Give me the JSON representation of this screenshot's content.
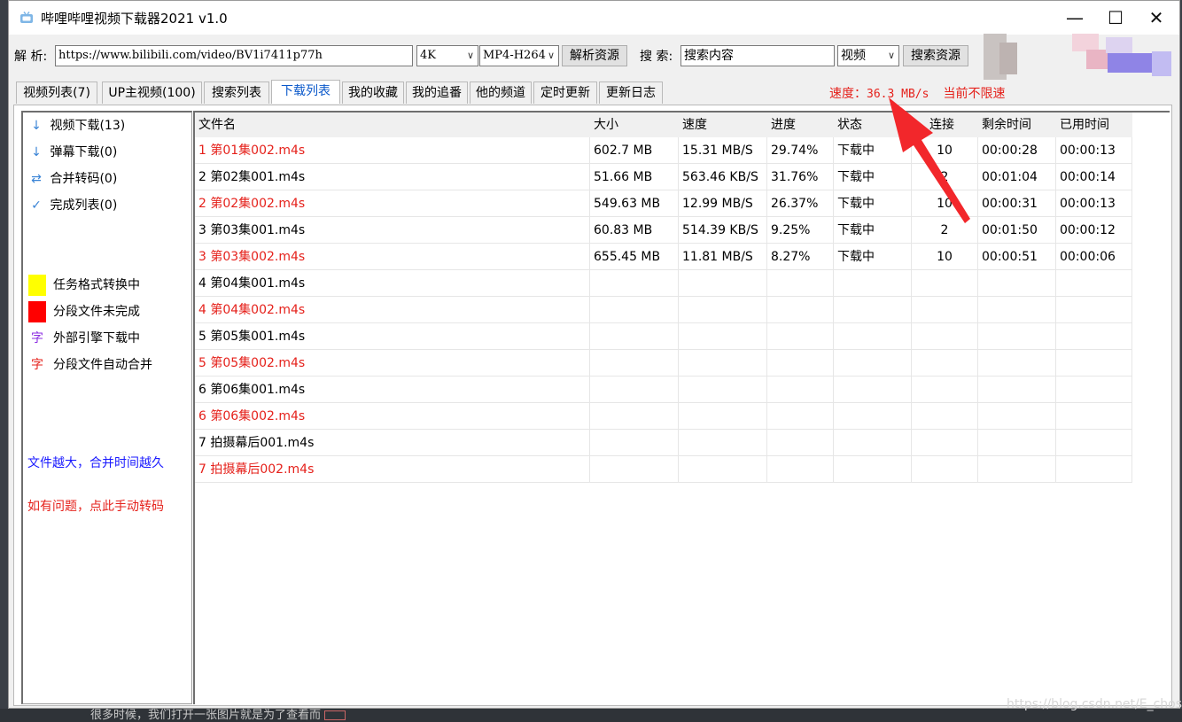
{
  "window": {
    "title": "哔哩哔哩视频下载器2021 v1.0",
    "controls": {
      "minimize": "—",
      "maximize": "☐",
      "close": "✕"
    }
  },
  "toolbar": {
    "parse_label": "解 析:",
    "url_value": "https://www.bilibili.com/video/BV1i7411p77h",
    "quality_value": "4K",
    "codec_value": "MP4-H264",
    "parse_button": "解析资源",
    "search_label": "搜 索:",
    "search_value": "搜索内容",
    "search_type_value": "视频",
    "search_button": "搜索资源"
  },
  "tabs": [
    {
      "label": "视频列表(7)"
    },
    {
      "label": "UP主视频(100)"
    },
    {
      "label": "搜索列表"
    },
    {
      "label": "下载列表",
      "active": true
    },
    {
      "label": "我的收藏"
    },
    {
      "label": "我的追番"
    },
    {
      "label": "他的频道"
    },
    {
      "label": "定时更新"
    },
    {
      "label": "更新日志"
    }
  ],
  "speed": {
    "label": "速度：",
    "value": "36.3 MB/s",
    "limit_text": "当前不限速"
  },
  "sidebar": {
    "items": [
      {
        "icon": "↓",
        "icon_name": "download-arrow-icon",
        "label": "视频下载(13)"
      },
      {
        "icon": "↓",
        "icon_name": "download-arrow-icon",
        "label": "弹幕下载(0)"
      },
      {
        "icon": "⇄",
        "icon_name": "swap-arrows-icon",
        "label": "合并转码(0)"
      },
      {
        "icon": "✓",
        "icon_name": "checkmark-icon",
        "label": "完成列表(0)"
      }
    ],
    "legend": [
      {
        "color": "#ffff00",
        "label": "任务格式转换中"
      },
      {
        "color": "#ff0000",
        "label": "分段文件未完成"
      },
      {
        "glyph": "字",
        "glyph_color": "#8b2be2",
        "label": "外部引擎下载中"
      },
      {
        "glyph": "字",
        "glyph_color": "#e5211b",
        "label": "分段文件自动合并"
      }
    ],
    "note_blue": "文件越大，合并时间越久",
    "note_red": "如有问题，点此手动转码"
  },
  "table": {
    "headers": [
      "文件名",
      "大小",
      "速度",
      "进度",
      "状态",
      "连接",
      "剩余时间",
      "已用时间"
    ],
    "rows": [
      {
        "name": "1 第01集002.m4s",
        "size": "602.7 MB",
        "speed": "15.31 MB/S",
        "progress": "29.74%",
        "status": "下载中",
        "conn": "10",
        "remain": "00:00:28",
        "used": "00:00:13",
        "red": true
      },
      {
        "name": "2 第02集001.m4s",
        "size": "51.66 MB",
        "speed": "563.46 KB/S",
        "progress": "31.76%",
        "status": "下载中",
        "conn": "2",
        "remain": "00:01:04",
        "used": "00:00:14",
        "red": false
      },
      {
        "name": "2 第02集002.m4s",
        "size": "549.63 MB",
        "speed": "12.99 MB/S",
        "progress": "26.37%",
        "status": "下载中",
        "conn": "10",
        "remain": "00:00:31",
        "used": "00:00:13",
        "red": true
      },
      {
        "name": "3 第03集001.m4s",
        "size": "60.83 MB",
        "speed": "514.39 KB/S",
        "progress": "9.25%",
        "status": "下载中",
        "conn": "2",
        "remain": "00:01:50",
        "used": "00:00:12",
        "red": false
      },
      {
        "name": "3 第03集002.m4s",
        "size": "655.45 MB",
        "speed": "11.81 MB/S",
        "progress": "8.27%",
        "status": "下载中",
        "conn": "10",
        "remain": "00:00:51",
        "used": "00:00:06",
        "red": true
      },
      {
        "name": "4 第04集001.m4s",
        "size": "",
        "speed": "",
        "progress": "",
        "status": "",
        "conn": "",
        "remain": "",
        "used": "",
        "red": false
      },
      {
        "name": "4 第04集002.m4s",
        "size": "",
        "speed": "",
        "progress": "",
        "status": "",
        "conn": "",
        "remain": "",
        "used": "",
        "red": true
      },
      {
        "name": "5 第05集001.m4s",
        "size": "",
        "speed": "",
        "progress": "",
        "status": "",
        "conn": "",
        "remain": "",
        "used": "",
        "red": false
      },
      {
        "name": "5 第05集002.m4s",
        "size": "",
        "speed": "",
        "progress": "",
        "status": "",
        "conn": "",
        "remain": "",
        "used": "",
        "red": true
      },
      {
        "name": "6 第06集001.m4s",
        "size": "",
        "speed": "",
        "progress": "",
        "status": "",
        "conn": "",
        "remain": "",
        "used": "",
        "red": false
      },
      {
        "name": "6 第06集002.m4s",
        "size": "",
        "speed": "",
        "progress": "",
        "status": "",
        "conn": "",
        "remain": "",
        "used": "",
        "red": true
      },
      {
        "name": "7 拍摄幕后001.m4s",
        "size": "",
        "speed": "",
        "progress": "",
        "status": "",
        "conn": "",
        "remain": "",
        "used": "",
        "red": false
      },
      {
        "name": "7 拍摄幕后002.m4s",
        "size": "",
        "speed": "",
        "progress": "",
        "status": "",
        "conn": "",
        "remain": "",
        "used": "",
        "red": true
      }
    ]
  },
  "background_text": "很多时候，我们打开一张图片就是为了查看而",
  "watermark": "https://blog.csdn.net/E_chos",
  "colors": {
    "accent_red": "#e5211b",
    "tab_active_blue": "#0a58ca",
    "note_blue": "#1a1aff"
  }
}
